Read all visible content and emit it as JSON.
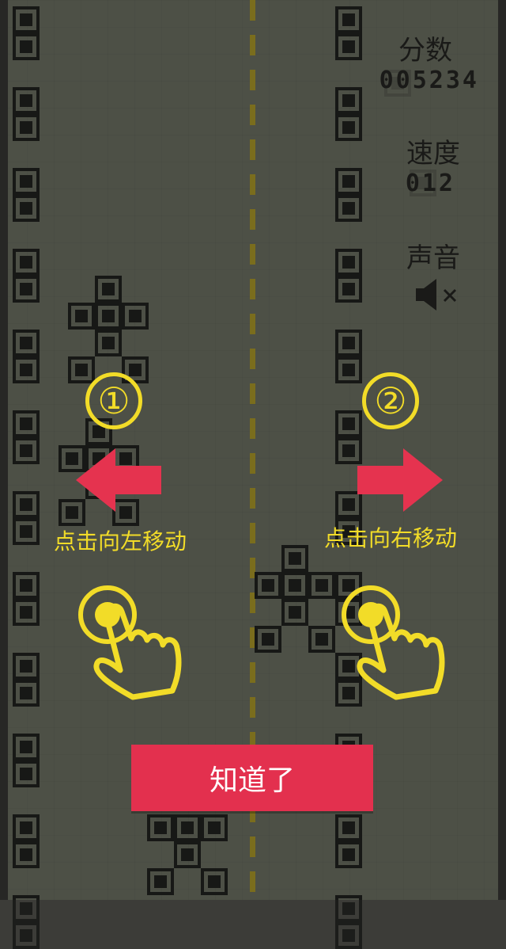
{
  "hud": {
    "score_label": "分数",
    "score_value": "005234",
    "speed_label": "速度",
    "speed_value": "012",
    "sound_label": "声音",
    "sound_state": "muted",
    "sound_icon": "speaker-muted-icon"
  },
  "tutorial": {
    "step_left_number": "①",
    "step_right_number": "②",
    "left_hint": "点击向左移动",
    "right_hint": "点击向右移动",
    "left_arrow_icon": "arrow-left-icon",
    "right_arrow_icon": "arrow-right-icon",
    "tap_icon": "tap-hand-icon",
    "got_it_button": "知道了"
  },
  "colors": {
    "lcd_background": "#929986",
    "block": "#1c1d1b",
    "center_line": "#f5d92a",
    "hint_yellow": "#f2dc28",
    "arrow_red": "#e5334f",
    "button_red": "#e3304e"
  }
}
